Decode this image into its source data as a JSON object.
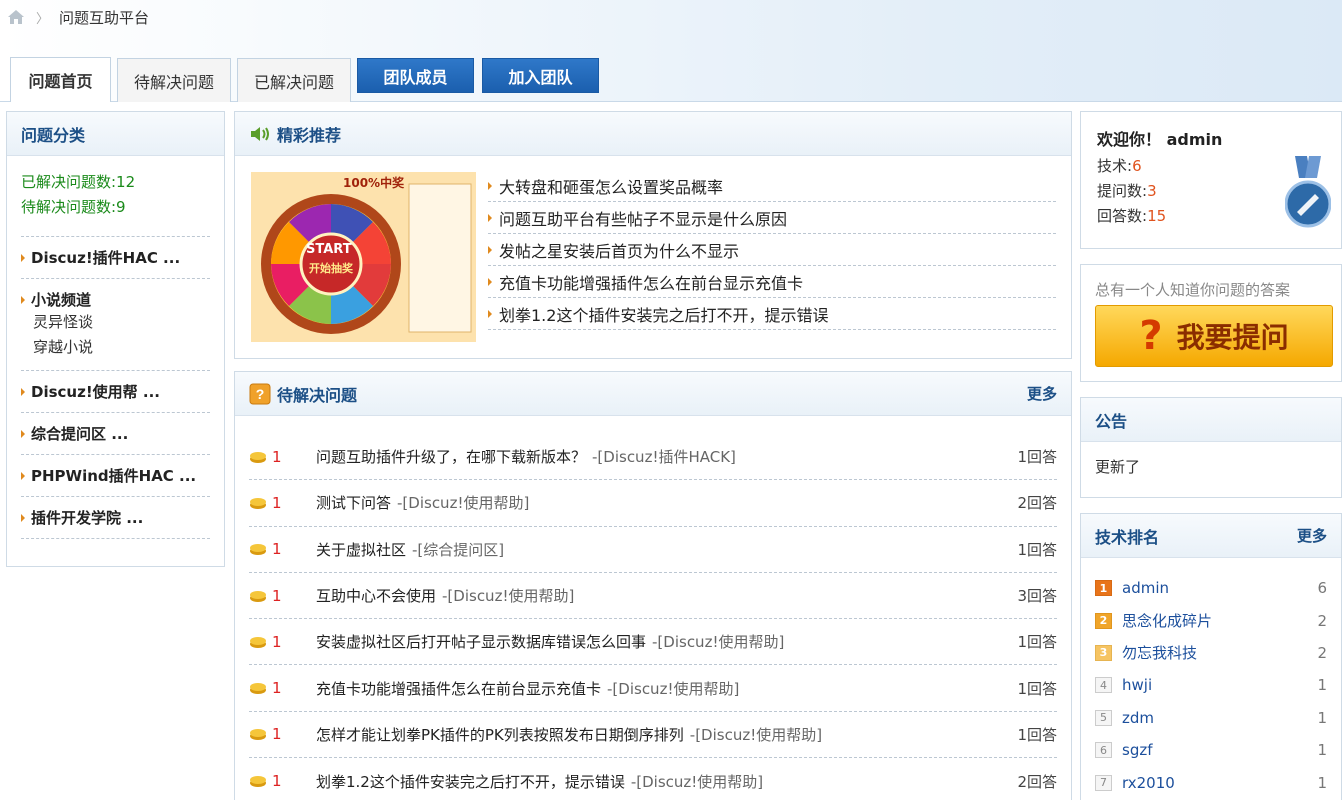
{
  "breadcrumb": {
    "title": "问题互助平台"
  },
  "tabs": [
    {
      "label": "问题首页"
    },
    {
      "label": "待解决问题"
    },
    {
      "label": "已解决问题"
    },
    {
      "label": "团队成员"
    },
    {
      "label": "加入团队"
    }
  ],
  "sidebar": {
    "heading": "问题分类",
    "solved": "已解决问题数:12",
    "pending": "待解决问题数:9",
    "categories": [
      {
        "label": "Discuz!插件HAC ..."
      },
      {
        "label": "小说频道",
        "subs": [
          "灵异怪谈",
          "穿越小说"
        ]
      },
      {
        "label": "Discuz!使用帮 ..."
      },
      {
        "label": "综合提问区 ..."
      },
      {
        "label": "PHPWind插件HAC ..."
      },
      {
        "label": "插件开发学院 ..."
      }
    ]
  },
  "featured": {
    "heading": "精彩推荐",
    "image": {
      "badge": "100%中奖",
      "start": "START",
      "sub": "开始抽奖"
    },
    "items": [
      "大转盘和砸蛋怎么设置奖品概率",
      "问题互助平台有些帖子不显示是什么原因",
      "发帖之星安装后首页为什么不显示",
      "充值卡功能增强插件怎么在前台显示充值卡",
      "划拳1.2这个插件安装完之后打不开，提示错误"
    ]
  },
  "pending": {
    "heading": "待解决问题",
    "more": "更多",
    "rows": [
      {
        "reward": "1",
        "title": "问题互助插件升级了，在哪下载新版本？",
        "category": "-[Discuz!插件HACK]",
        "answers": "1回答"
      },
      {
        "reward": "1",
        "title": "测试下问答",
        "category": "-[Discuz!使用帮助]",
        "answers": "2回答"
      },
      {
        "reward": "1",
        "title": "关于虚拟社区",
        "category": "-[综合提问区]",
        "answers": "1回答"
      },
      {
        "reward": "1",
        "title": "互助中心不会使用",
        "category": "-[Discuz!使用帮助]",
        "answers": "3回答"
      },
      {
        "reward": "1",
        "title": "安装虚拟社区后打开帖子显示数据库错误怎么回事",
        "category": "-[Discuz!使用帮助]",
        "answers": "1回答"
      },
      {
        "reward": "1",
        "title": "充值卡功能增强插件怎么在前台显示充值卡",
        "category": "-[Discuz!使用帮助]",
        "answers": "1回答"
      },
      {
        "reward": "1",
        "title": "怎样才能让划拳PK插件的PK列表按照发布日期倒序排列",
        "category": "-[Discuz!使用帮助]",
        "answers": "1回答"
      },
      {
        "reward": "1",
        "title": "划拳1.2这个插件安装完之后打不开，提示错误",
        "category": "-[Discuz!使用帮助]",
        "answers": "2回答"
      }
    ]
  },
  "welcome": {
    "greeting": "欢迎你！ admin",
    "tech_label": "技术:",
    "tech": "6",
    "asks_label": "提问数:",
    "asks": "3",
    "answers_label": "回答数:",
    "answers": "15"
  },
  "ask": {
    "tip": "总有一个人知道你问题的答案",
    "mark": "?",
    "button": "我要提问"
  },
  "notice": {
    "heading": "公告",
    "text": "更新了"
  },
  "ranking": {
    "heading": "技术排名",
    "more": "更多",
    "rows": [
      {
        "rank": "1",
        "name": "admin",
        "score": "6"
      },
      {
        "rank": "2",
        "name": "思念化成碎片",
        "score": "2"
      },
      {
        "rank": "3",
        "name": "勿忘我科技",
        "score": "2"
      },
      {
        "rank": "4",
        "name": "hwji",
        "score": "1"
      },
      {
        "rank": "5",
        "name": "zdm",
        "score": "1"
      },
      {
        "rank": "6",
        "name": "sgzf",
        "score": "1"
      },
      {
        "rank": "7",
        "name": "rx2010",
        "score": "1"
      }
    ]
  },
  "colors": {
    "accent": "#1c4f86",
    "tab_blue": "#2469b9",
    "green": "#1a8a1a",
    "red": "#dd2222",
    "orange": "#e0531e"
  }
}
